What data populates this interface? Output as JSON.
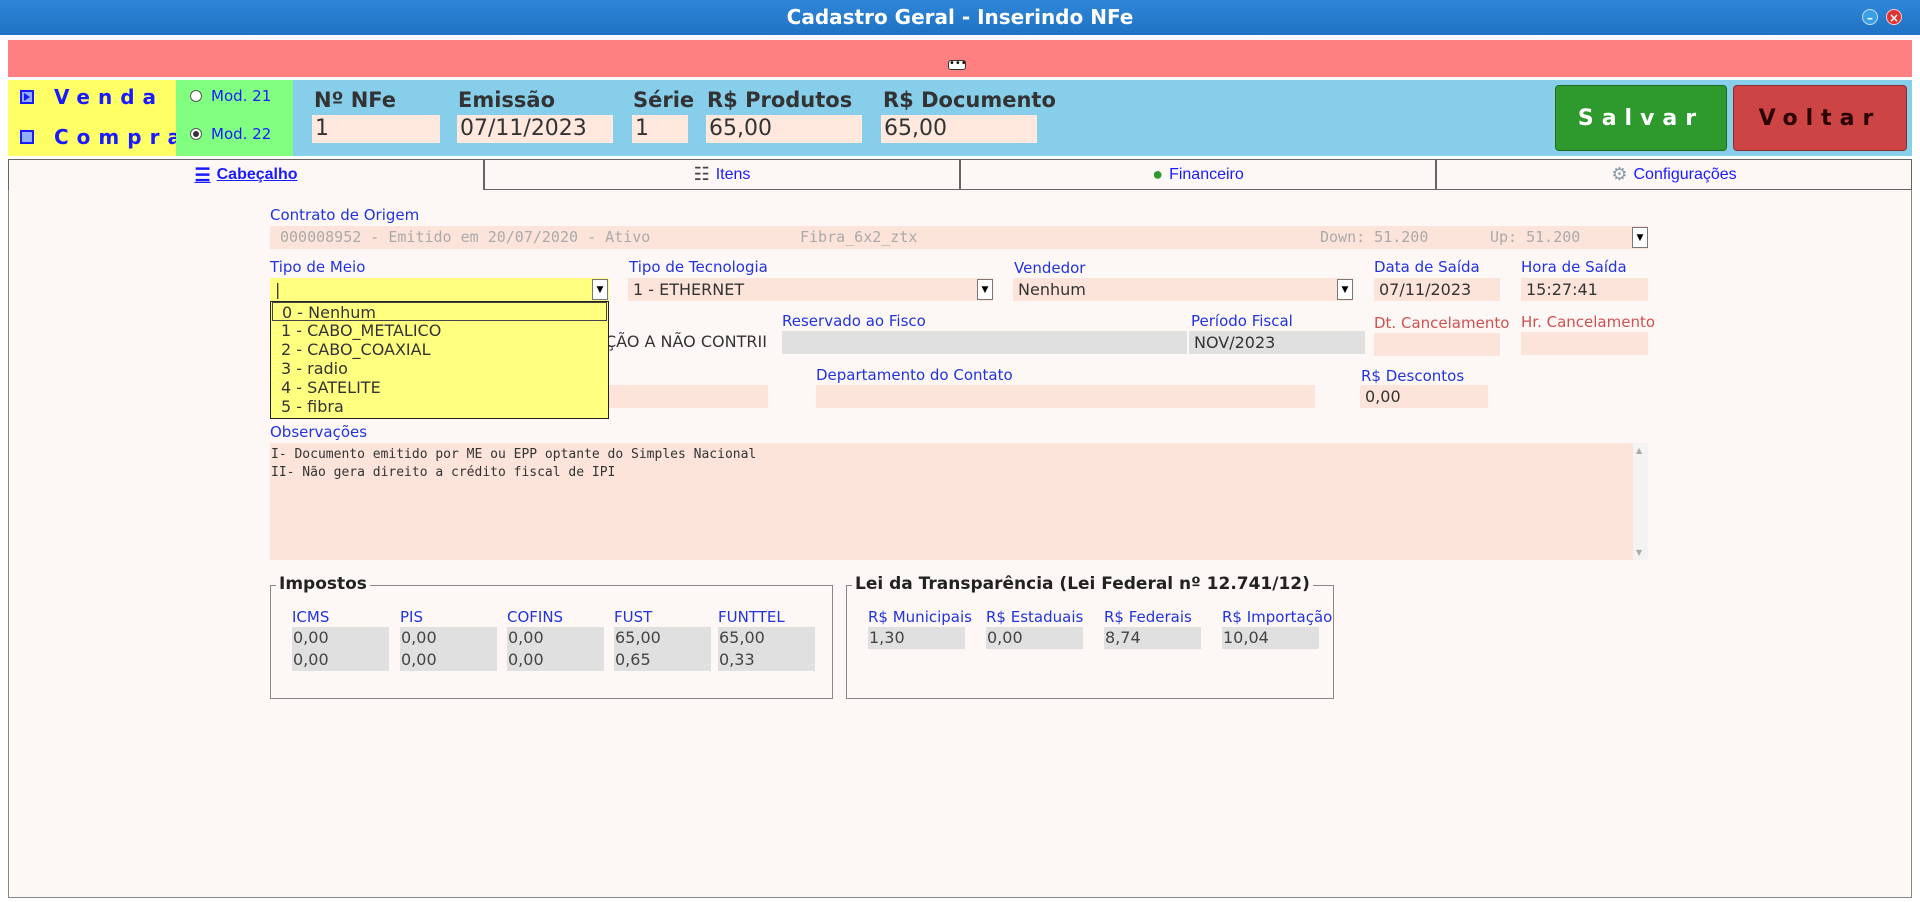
{
  "window": {
    "title": "Cadastro Geral - Inserindo NFe",
    "minimize": "–",
    "close": "×"
  },
  "pinkbar": {
    "ellipsis": "•••"
  },
  "tipo_nota": {
    "venda": "Venda",
    "compra": "Compra"
  },
  "modelo": {
    "mod21": "Mod. 21",
    "mod22": "Mod. 22"
  },
  "header": {
    "nfe_label": "Nº NFe",
    "nfe_value": "1",
    "emissao_label": "Emissão",
    "emissao_value": "07/11/2023",
    "serie_label": "Série",
    "serie_value": "1",
    "produtos_label": "R$ Produtos",
    "produtos_value": "65,00",
    "documento_label": "R$ Documento",
    "documento_value": "65,00"
  },
  "actions": {
    "salvar": "Salvar",
    "voltar": "Voltar"
  },
  "tabs": [
    {
      "label": "Cabeçalho",
      "icon": "list-box-icon"
    },
    {
      "label": "Itens",
      "icon": "list-icon"
    },
    {
      "label": "Financeiro",
      "icon": "money-bag-icon"
    },
    {
      "label": "Configurações",
      "icon": "gears-icon"
    }
  ],
  "form": {
    "contrato_label": "Contrato de Origem",
    "contrato_value": "000008952 - Emitido em 20/07/2020 - Ativo",
    "contrato_plano": "Fibra_6x2_ztx",
    "contrato_down": "Down: 51.200",
    "contrato_up": "Up: 51.200",
    "tipo_meio_label": "Tipo de Meio",
    "tipo_meio_value": "|",
    "tipo_meio_options": [
      "0 - Nenhum",
      "1 - CABO_METALICO",
      "2 - CABO_COAXIAL",
      "3 - radio",
      "4 - SATELITE",
      "5 - fibra"
    ],
    "tecnologia_label": "Tipo de Tecnologia",
    "tecnologia_value": "1 - ETHERNET",
    "vendedor_label": "Vendedor",
    "vendedor_value": "Nenhum",
    "data_saida_label": "Data de Saída",
    "data_saida_value": "07/11/2023",
    "hora_saida_label": "Hora de Saída",
    "hora_saida_value": "15:27:41",
    "cfop_value": "ÇÃO A NÃO CONTRII",
    "reservado_label": "Reservado ao Fisco",
    "periodo_label": "Período Fiscal",
    "periodo_value": "NOV/2023",
    "dt_cancel_label": "Dt. Cancelamento",
    "hr_cancel_label": "Hr. Cancelamento",
    "departamento_label": "Departamento do Contato",
    "descontos_label": "R$ Descontos",
    "descontos_value": "0,00",
    "observacoes_label": "Observações",
    "observacoes_line1": "I- Documento emitido por ME ou EPP optante do Simples Nacional",
    "observacoes_line2": "II- Não gera direito a crédito fiscal de IPI"
  },
  "impostos": {
    "title": "Impostos",
    "cols": [
      {
        "label": "ICMS",
        "base": "0,00",
        "valor": "0,00"
      },
      {
        "label": "PIS",
        "base": "0,00",
        "valor": "0,00"
      },
      {
        "label": "COFINS",
        "base": "0,00",
        "valor": "0,00"
      },
      {
        "label": "FUST",
        "base": "65,00",
        "valor": "0,65"
      },
      {
        "label": "FUNTTEL",
        "base": "65,00",
        "valor": "0,33"
      }
    ]
  },
  "transparencia": {
    "title": "Lei da Transparência (Lei Federal nº 12.741/12)",
    "cols": [
      {
        "label": "R$ Municipais",
        "value": "1,30"
      },
      {
        "label": "R$ Estaduais",
        "value": "0,00"
      },
      {
        "label": "R$ Federais",
        "value": "8,74"
      },
      {
        "label": "R$ Importação",
        "value": "10,04"
      }
    ]
  },
  "colors": {
    "title_bar": "#1f72c4",
    "pink_bar": "#ff8080",
    "header_bg": "#87ceeb",
    "salvar": "#2e9a2e",
    "voltar": "#cc4444",
    "label_blue": "#2233dd",
    "field_bg": "#fde4da"
  }
}
